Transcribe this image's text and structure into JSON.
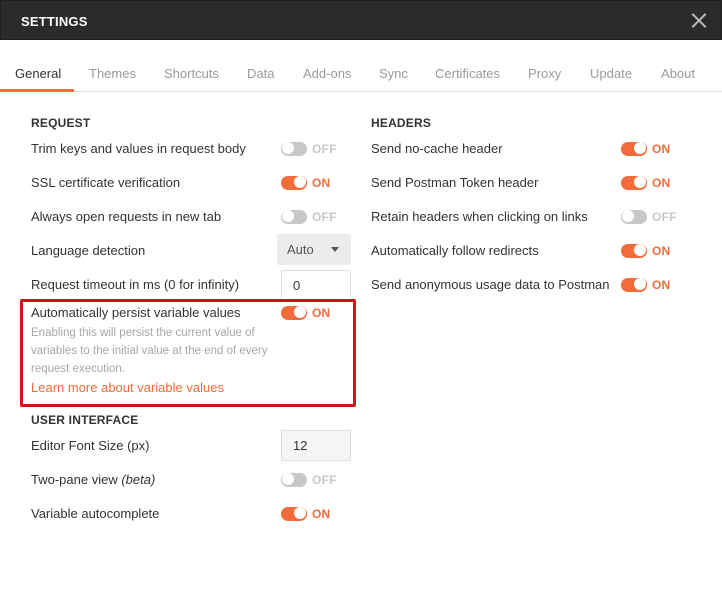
{
  "window": {
    "title": "SETTINGS"
  },
  "tabs": [
    {
      "label": "General",
      "active": true
    },
    {
      "label": "Themes"
    },
    {
      "label": "Shortcuts"
    },
    {
      "label": "Data"
    },
    {
      "label": "Add-ons"
    },
    {
      "label": "Sync"
    },
    {
      "label": "Certificates"
    },
    {
      "label": "Proxy"
    },
    {
      "label": "Update"
    },
    {
      "label": "About"
    }
  ],
  "request": {
    "title": "REQUEST",
    "trim": {
      "label": "Trim keys and values in request body",
      "state": "OFF"
    },
    "ssl": {
      "label": "SSL certificate verification",
      "state": "ON"
    },
    "new_tab": {
      "label": "Always open requests in new tab",
      "state": "OFF"
    },
    "language": {
      "label": "Language detection",
      "value": "Auto"
    },
    "timeout": {
      "label": "Request timeout in ms (0 for infinity)",
      "value": "0"
    },
    "persist": {
      "label": "Automatically persist variable values",
      "state": "ON",
      "help": "Enabling this will persist the current value of variables to the initial value at the end of every request execution.",
      "link": "Learn more about variable values"
    }
  },
  "ui": {
    "title": "USER INTERFACE",
    "font_size": {
      "label": "Editor Font Size (px)",
      "value": "12"
    },
    "two_pane": {
      "label": "Two-pane view ",
      "label_suffix": "(beta)",
      "state": "OFF"
    },
    "autocomplete": {
      "label": "Variable autocomplete",
      "state": "ON"
    }
  },
  "headers": {
    "title": "HEADERS",
    "no_cache": {
      "label": "Send no-cache header",
      "state": "ON"
    },
    "postman_token": {
      "label": "Send Postman Token header",
      "state": "ON"
    },
    "retain": {
      "label": "Retain headers when clicking on links",
      "state": "OFF"
    },
    "redirects": {
      "label": "Automatically follow redirects",
      "state": "ON"
    },
    "usage": {
      "label": "Send anonymous usage data to Postman",
      "state": "ON"
    }
  },
  "icons": {
    "close": "close-icon",
    "select": "chevron-down-icon"
  },
  "colors": {
    "accent": "#f26b3a",
    "highlight": "#d0101c",
    "titlebar": "#2b2b2b",
    "toggle_off": "#c8c8c8"
  }
}
